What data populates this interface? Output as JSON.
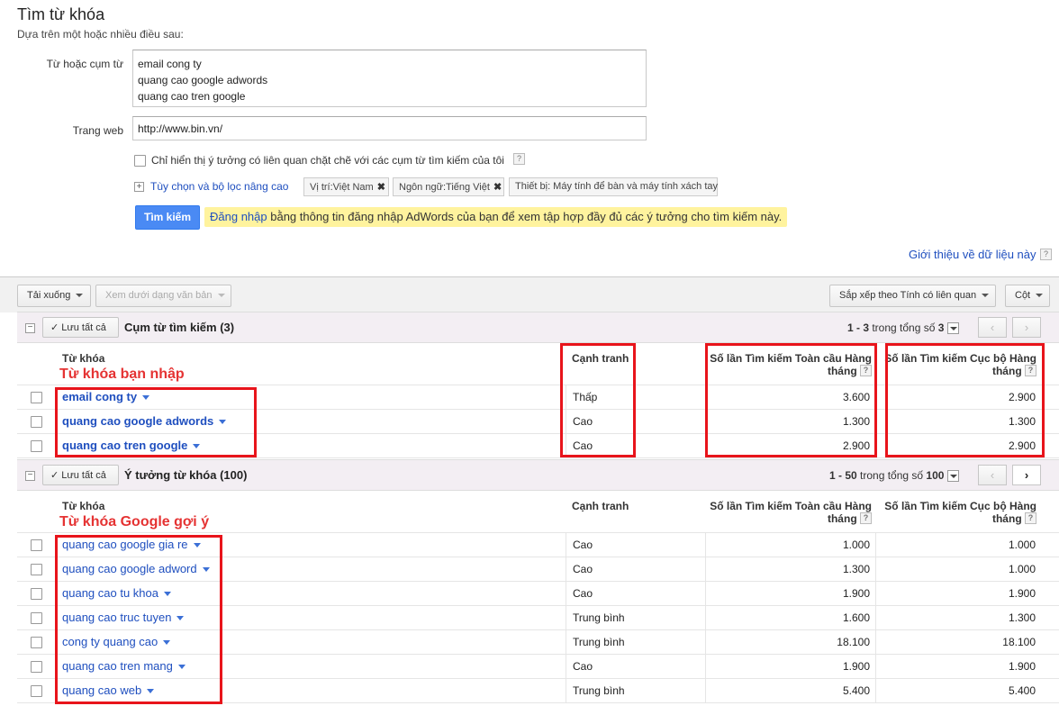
{
  "header": {
    "title": "Tìm từ khóa",
    "subtitle": "Dựa trên một hoặc nhiều điều sau:"
  },
  "form": {
    "words_label": "Từ hoặc cụm từ",
    "words_lines": [
      "email cong ty",
      "quang cao google adwords",
      "quang cao tren google"
    ],
    "website_label": "Trang web",
    "website_value": "http://www.bin.vn/",
    "only_related_label": "Chỉ hiển thị ý tưởng có liên quan chặt chẽ với các cụm từ tìm kiếm của tôi",
    "qmark": "?",
    "plus": "+",
    "advanced_link": "Tùy chọn và bộ lọc nâng cao",
    "chips": {
      "location": "Vị trí:Việt Nam",
      "language": "Ngôn ngữ:Tiếng Việt",
      "device": "Thiết bị: Máy tính để bàn và máy tính xách tay",
      "close": "✖"
    },
    "search_button": "Tìm kiếm",
    "signin_link": "Đăng nhập",
    "signin_text": " bằng thông tin đăng nhập AdWords của bạn để xem tập hợp đầy đủ các ý tưởng cho tìm kiếm này.",
    "intro_link": "Giới thiệu về dữ liệu này"
  },
  "toolbar": {
    "download": "Tải xuống",
    "view_as_text": "Xem dưới dạng văn bản",
    "sort": "Sắp xếp theo Tính có liên quan",
    "columns": "Cột"
  },
  "columns": {
    "keyword": "Từ khóa",
    "competition": "Cạnh tranh",
    "global_line1": "Số lần Tìm kiếm Toàn cầu Hàng",
    "global_line2": "tháng",
    "local_line1": "Số lần Tìm kiếm Cục bộ Hàng",
    "local_line2": "tháng"
  },
  "section1": {
    "minus": "−",
    "save_all": "Lưu tất cả",
    "check": "✓",
    "title": "Cụm từ tìm kiếm (3)",
    "pager_range": "1 - 3",
    "pager_mid": " trong tổng số ",
    "pager_total": "3",
    "prev": "‹",
    "next": "›",
    "annotation": "Từ khóa bạn nhập",
    "rows": [
      {
        "keyword": "email cong ty",
        "competition": "Thấp",
        "global": "3.600",
        "local": "2.900"
      },
      {
        "keyword": "quang cao google adwords",
        "competition": "Cao",
        "global": "1.300",
        "local": "1.300"
      },
      {
        "keyword": "quang cao tren google",
        "competition": "Cao",
        "global": "2.900",
        "local": "2.900"
      }
    ]
  },
  "section2": {
    "minus": "−",
    "save_all": "Lưu tất cả",
    "check": "✓",
    "title": "Ý tưởng từ khóa (100)",
    "pager_range": "1 - 50",
    "pager_mid": " trong tổng số ",
    "pager_total": "100",
    "prev": "‹",
    "next": "›",
    "annotation": "Từ khóa Google gợi ý",
    "rows": [
      {
        "keyword": "quang cao google gia re",
        "competition": "Cao",
        "global": "1.000",
        "local": "1.000"
      },
      {
        "keyword": "quang cao google adword",
        "competition": "Cao",
        "global": "1.300",
        "local": "1.000"
      },
      {
        "keyword": "quang cao tu khoa",
        "competition": "Cao",
        "global": "1.900",
        "local": "1.900"
      },
      {
        "keyword": "quang cao truc tuyen",
        "competition": "Trung bình",
        "global": "1.600",
        "local": "1.300"
      },
      {
        "keyword": "cong ty quang cao",
        "competition": "Trung bình",
        "global": "18.100",
        "local": "18.100"
      },
      {
        "keyword": "quang cao tren mang",
        "competition": "Cao",
        "global": "1.900",
        "local": "1.900"
      },
      {
        "keyword": "quang cao web",
        "competition": "Trung bình",
        "global": "5.400",
        "local": "5.400"
      }
    ]
  }
}
